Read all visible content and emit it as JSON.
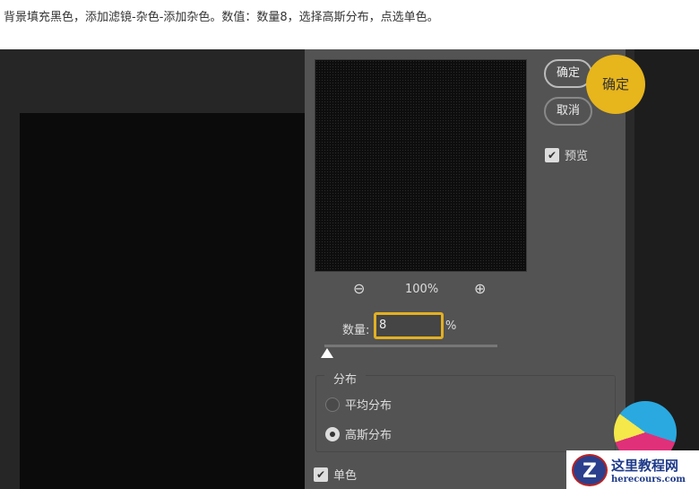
{
  "caption": "背景填充黑色，添加滤镜-杂色-添加杂色。数值：数量8，选择高斯分布，点选单色。",
  "dialog": {
    "zoom_level": "100%",
    "amount_label": "数量:",
    "amount_value": "8",
    "amount_unit": "%",
    "amount_slider_fraction": 0.02,
    "distribution_label": "分布",
    "radio_uniform": "平均分布",
    "radio_gaussian": "高斯分布",
    "selected_distribution": "高斯分布",
    "monochrome_label": "单色",
    "monochrome_checked": true,
    "ok_label": "确定",
    "cancel_label": "取消",
    "preview_label": "预览",
    "preview_checked": true,
    "check_glyph": "✔"
  },
  "callout": {
    "text": "确定",
    "color": "#e7b51c"
  },
  "watermark": {
    "title": "这里教程网",
    "url": "herecours.com",
    "logo_letter": "Z"
  }
}
